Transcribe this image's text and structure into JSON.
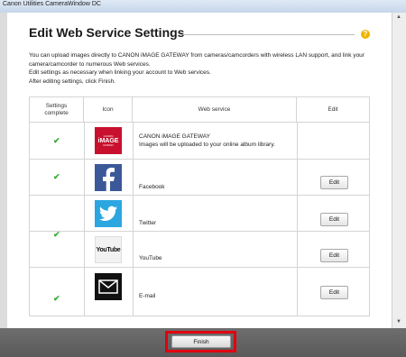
{
  "window": {
    "title": "Canon Utilities CameraWindow DC"
  },
  "page": {
    "title": "Edit Web Service Settings",
    "help_icon": "question-mark-icon",
    "description": [
      "You can upload images directly to CANON iMAGE GATEWAY from cameras/camcorders with wireless LAN support, and link your",
      "camera/camcorder to numerous Web services.",
      "Edit settings as necessary when linking your account to Web services.",
      "After editing settings, click Finish."
    ]
  },
  "table": {
    "headers": {
      "complete": "Settings\ncomplete",
      "icon": "Icon",
      "service": "Web service",
      "edit": "Edit"
    },
    "rows": [
      {
        "complete": true,
        "icon": "canon-image-gateway-icon",
        "service": "CANON iMAGE GATEWAY",
        "note": "Images will be uploaded to your online album library.",
        "edit_label": ""
      },
      {
        "complete": true,
        "icon": "facebook-icon",
        "service": "Facebook",
        "edit_label": "Edit"
      },
      {
        "complete": true,
        "icon": "twitter-icon",
        "service": "Twitter",
        "edit_label": "Edit"
      },
      {
        "complete": false,
        "icon": "youtube-icon",
        "service": "YouTube",
        "edit_label": "Edit"
      },
      {
        "complete": true,
        "icon": "email-icon",
        "service": "E-mail",
        "edit_label": "Edit"
      }
    ],
    "check_glyph": "✔",
    "canon_logo": {
      "top": "CANON",
      "main": "iMAGE",
      "bottom": "GATEWAY"
    },
    "youtube_logo": "YouTube"
  },
  "footer": {
    "finish_label": "Finish"
  },
  "colors": {
    "highlight": "#e0000f",
    "check": "#3aaa35",
    "facebook": "#3b5998",
    "twitter": "#2ba6e1",
    "canon": "#c8102e"
  }
}
